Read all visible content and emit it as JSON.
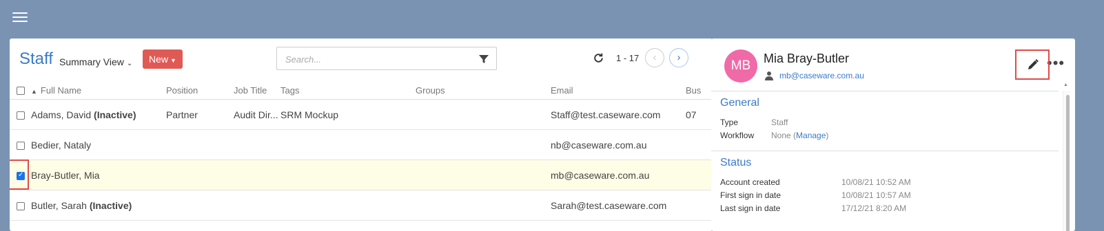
{
  "list": {
    "title": "Staff",
    "view_label": "Summary View",
    "new_label": "New",
    "search_placeholder": "Search...",
    "page_range": "1 - 17",
    "columns": [
      "Full Name",
      "Position",
      "Job Title",
      "Tags",
      "Groups",
      "Email",
      "Bus"
    ],
    "rows": [
      {
        "name": "Adams, David",
        "status": "(Inactive)",
        "position": "Partner",
        "job_title": "Audit Dir...",
        "tags": "SRM Mockup",
        "groups": "",
        "email": "Staff@test.caseware.com",
        "extra": "07",
        "checked": false
      },
      {
        "name": "Bedier, Nataly",
        "status": "",
        "position": "",
        "job_title": "",
        "tags": "",
        "groups": "",
        "email": "nb@caseware.com.au",
        "extra": "",
        "checked": false
      },
      {
        "name": "Bray-Butler, Mia",
        "status": "",
        "position": "",
        "job_title": "",
        "tags": "",
        "groups": "",
        "email": "mb@caseware.com.au",
        "extra": "",
        "checked": true
      },
      {
        "name": "Butler, Sarah",
        "status": "(Inactive)",
        "position": "",
        "job_title": "",
        "tags": "",
        "groups": "",
        "email": "Sarah@test.caseware.com",
        "extra": "",
        "checked": false
      }
    ]
  },
  "detail": {
    "initials": "MB",
    "name": "Mia Bray-Butler",
    "email": "mb@caseware.com.au",
    "general": {
      "title": "General",
      "type_label": "Type",
      "type_value": "Staff",
      "workflow_label": "Workflow",
      "workflow_value": "None (",
      "workflow_link": "Manage",
      "workflow_suffix": ")"
    },
    "status": {
      "title": "Status",
      "items": [
        {
          "label": "Account created",
          "value": "10/08/21 10:52 AM"
        },
        {
          "label": "First sign in date",
          "value": "10/08/21 10:57 AM"
        },
        {
          "label": "Last sign in date",
          "value": "17/12/21 8:20 AM"
        }
      ]
    }
  },
  "colors": {
    "background": "#7a93b3",
    "accent": "#3a7bc8",
    "new_button": "#e05a55",
    "avatar": "#f06aa8",
    "selected_row": "#fefde6",
    "highlight_box": "#e04a4a"
  },
  "icons": [
    "hamburger-icon",
    "chevron-down-icon",
    "filter-icon",
    "refresh-icon",
    "chevron-left-icon",
    "chevron-right-icon",
    "sort-up-icon",
    "person-icon",
    "pencil-icon",
    "more-icon"
  ]
}
